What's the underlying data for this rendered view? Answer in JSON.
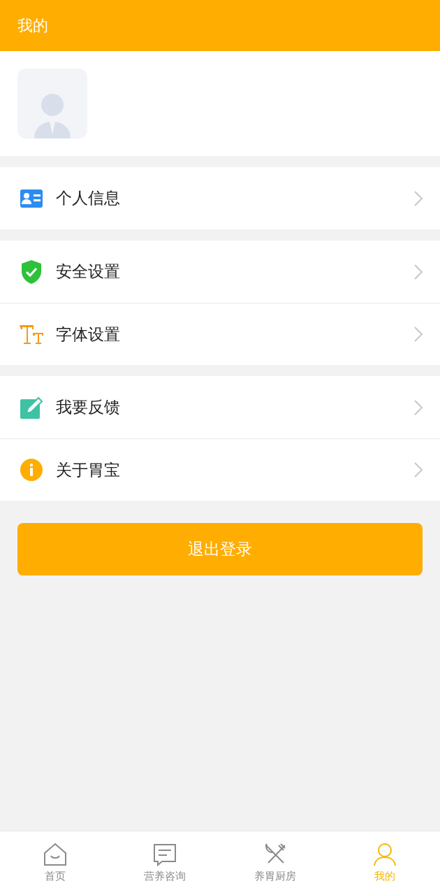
{
  "header": {
    "title": "我的"
  },
  "groups": [
    {
      "items": [
        {
          "kind": "idcard",
          "label": "个人信息"
        }
      ]
    },
    {
      "items": [
        {
          "kind": "shield",
          "label": "安全设置"
        },
        {
          "kind": "font",
          "label": "字体设置"
        }
      ]
    },
    {
      "items": [
        {
          "kind": "edit",
          "label": "我要反馈"
        },
        {
          "kind": "info",
          "label": "关于胃宝"
        }
      ]
    }
  ],
  "logout_button": "退出登录",
  "tabs": [
    {
      "kind": "home",
      "label": "首页",
      "selected": false
    },
    {
      "kind": "chat",
      "label": "营养咨询",
      "selected": false
    },
    {
      "kind": "kitchen",
      "label": "养胃厨房",
      "selected": false
    },
    {
      "kind": "user",
      "label": "我的",
      "selected": true
    }
  ]
}
